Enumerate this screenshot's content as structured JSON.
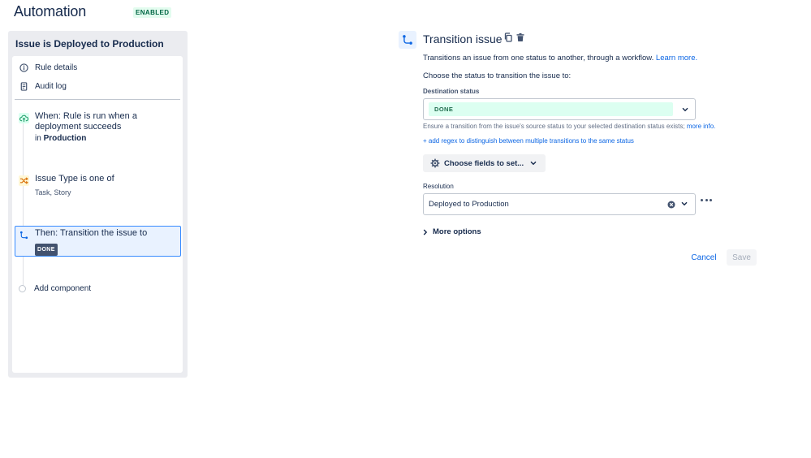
{
  "app": {
    "title": "Automation",
    "status_badge": "ENABLED"
  },
  "rule": {
    "title": "Issue is Deployed to Production",
    "nav": [
      {
        "label": "Rule details",
        "icon": "info-icon"
      },
      {
        "label": "Audit log",
        "icon": "document-icon"
      }
    ],
    "components": [
      {
        "text": "When: Rule is run when a deployment succeeds",
        "sub_prefix": "in",
        "sub_value": "Production",
        "icon": "cloud-upload-icon",
        "icon_color": "#22a06b"
      },
      {
        "text": "Issue Type is one of",
        "sub": "Task, Story",
        "icon": "shuffle-icon",
        "icon_color": "#e2b203"
      },
      {
        "text": "Then: Transition the issue to",
        "lozenge": "DONE",
        "icon": "transition-icon",
        "icon_color": "#0c66e4"
      }
    ],
    "add_component": "Add component"
  },
  "editor": {
    "title": "Transition issue",
    "description": "Transitions an issue from one status to another, through a workflow.",
    "learn_more": "Learn more.",
    "prompt": "Choose the status to transition the issue to:",
    "destination_label": "Destination status",
    "destination_value": "DONE",
    "help_text": "Ensure a transition from the issue's source status to your selected destination status exists;",
    "help_link": "more info.",
    "regex_link": "+ add regex to distinguish between multiple transitions to the same status",
    "choose_fields": "Choose fields to set...",
    "resolution_label": "Resolution",
    "resolution_value": "Deployed to Production",
    "more_options": "More options",
    "cancel": "Cancel",
    "save": "Save"
  },
  "colors": {
    "accent": "#0c66e4",
    "selected_bg": "#e9f2ff",
    "selected_border": "#388bff",
    "done_bg": "#dcfff1",
    "done_text": "#216e4e"
  }
}
